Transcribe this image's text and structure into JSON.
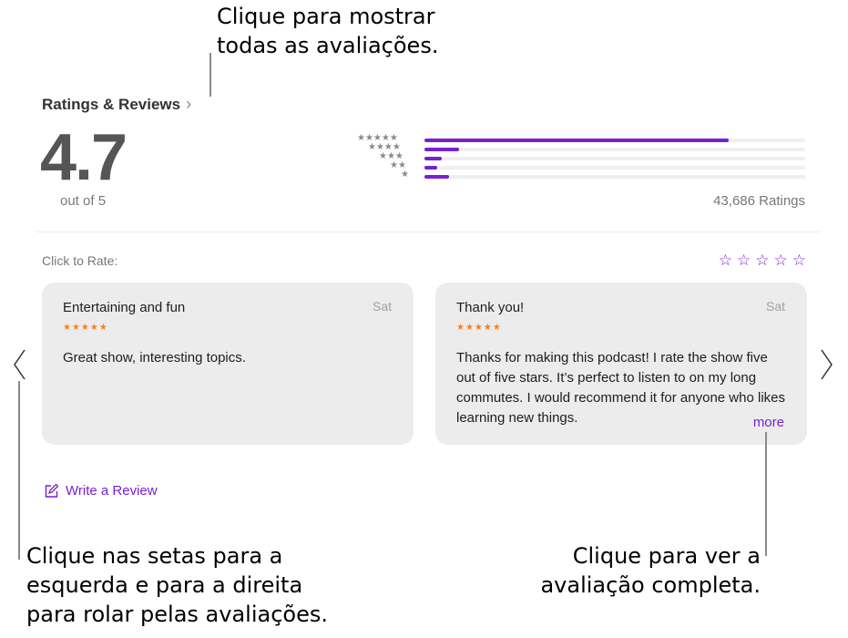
{
  "callouts": {
    "top": [
      "Clique para mostrar",
      "todas as avaliações."
    ],
    "left": [
      "Clique nas setas para a",
      "esquerda e para a direita",
      "para rolar pelas avaliações."
    ],
    "right": [
      "Clique para ver a",
      "avaliação completa."
    ]
  },
  "ratings": {
    "section_title": "Ratings & Reviews",
    "chevron_icon": "chevron-right-icon",
    "average": "4.7",
    "out_of": "out of 5",
    "total": "43,686 Ratings",
    "histogram": [
      {
        "stars": 5,
        "glyphs": "★★★★★",
        "fraction": 0.8
      },
      {
        "stars": 4,
        "glyphs": "★★★★",
        "fraction": 0.09
      },
      {
        "stars": 3,
        "glyphs": "★★★",
        "fraction": 0.045
      },
      {
        "stars": 2,
        "glyphs": "★★",
        "fraction": 0.033
      },
      {
        "stars": 1,
        "glyphs": "★",
        "fraction": 0.065
      }
    ],
    "accent_color": "#7a1fd1"
  },
  "rate": {
    "label": "Click to Rate:",
    "stars": [
      "☆",
      "☆",
      "☆",
      "☆",
      "☆"
    ]
  },
  "reviews": [
    {
      "title": "Entertaining and fun",
      "date": "Sat",
      "stars": "★★★★★",
      "body": "Great show, interesting topics."
    },
    {
      "title": "Thank you!",
      "date": "Sat",
      "stars": "★★★★★",
      "body": "Thanks for making this podcast! I rate the show five out of five stars. It’s perfect to listen to on my long commutes. I would recommend it for anyone who likes learning new things.",
      "more_label": "more"
    }
  ],
  "navigation": {
    "prev_icon": "chevron-left-icon",
    "next_icon": "chevron-right-icon"
  },
  "write_review": {
    "label": "Write a Review",
    "icon": "compose-icon"
  }
}
